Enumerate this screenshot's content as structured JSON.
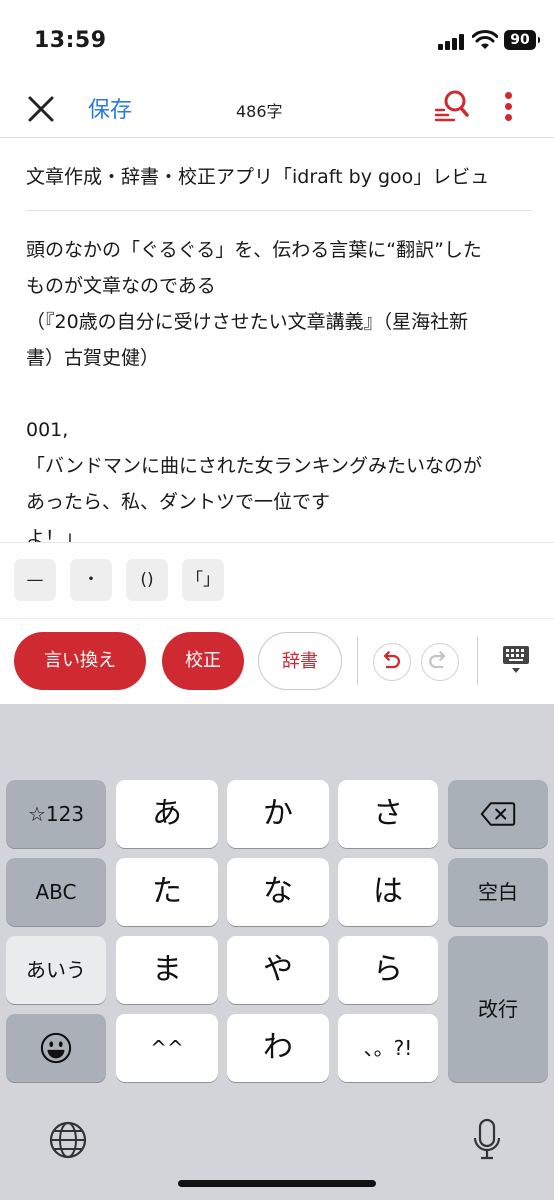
{
  "status": {
    "time": "13:59",
    "battery": "90"
  },
  "header": {
    "save_label": "保存",
    "char_count": "486字",
    "icons": {
      "close": "close-icon",
      "search": "search-proofread-icon",
      "more": "more-vertical-icon"
    }
  },
  "editor": {
    "title": "文章作成・辞書・校正アプリ「idraft by goo」レビュ",
    "lines": [
      "頭のなかの「ぐるぐる」を、伝わる言葉に“翻訳”した",
      "ものが文章なのである",
      "（『20歳の自分に受けさせたい文章講義』（星海社新",
      "書）古賀史健）",
      "",
      "001,",
      "「バンドマンに曲にされた女ランキングみたいなのが",
      "あったら、私、ダントツで一位です",
      "よ！」"
    ]
  },
  "symbols": [
    "—",
    "・",
    "()",
    "「」"
  ],
  "actions": {
    "rephrase": "言い換え",
    "proofread": "校正",
    "dictionary": "辞書",
    "icons": {
      "undo": "undo-icon",
      "redo": "redo-icon",
      "keyboard": "keyboard-hide-icon"
    }
  },
  "colors": {
    "accent_red": "#cf2a31",
    "link_blue": "#2a7be4",
    "keyboard_bg": "#d2d4da"
  },
  "keyboard": {
    "row1": {
      "mode": "☆123",
      "k1": "あ",
      "k2": "か",
      "k3": "さ",
      "delete_icon": "backspace-icon"
    },
    "row2": {
      "mode": "ABC",
      "k1": "た",
      "k2": "な",
      "k3": "は",
      "space": "空白"
    },
    "row3": {
      "mode": "あいう",
      "k1": "ま",
      "k2": "や",
      "k3": "ら",
      "enter": "改行"
    },
    "row4": {
      "emoji_icon": "emoji-icon",
      "k1": "^^",
      "k2": "わ",
      "k3": "、。?!"
    },
    "bottom": {
      "globe_icon": "globe-icon",
      "mic_icon": "microphone-icon"
    }
  }
}
